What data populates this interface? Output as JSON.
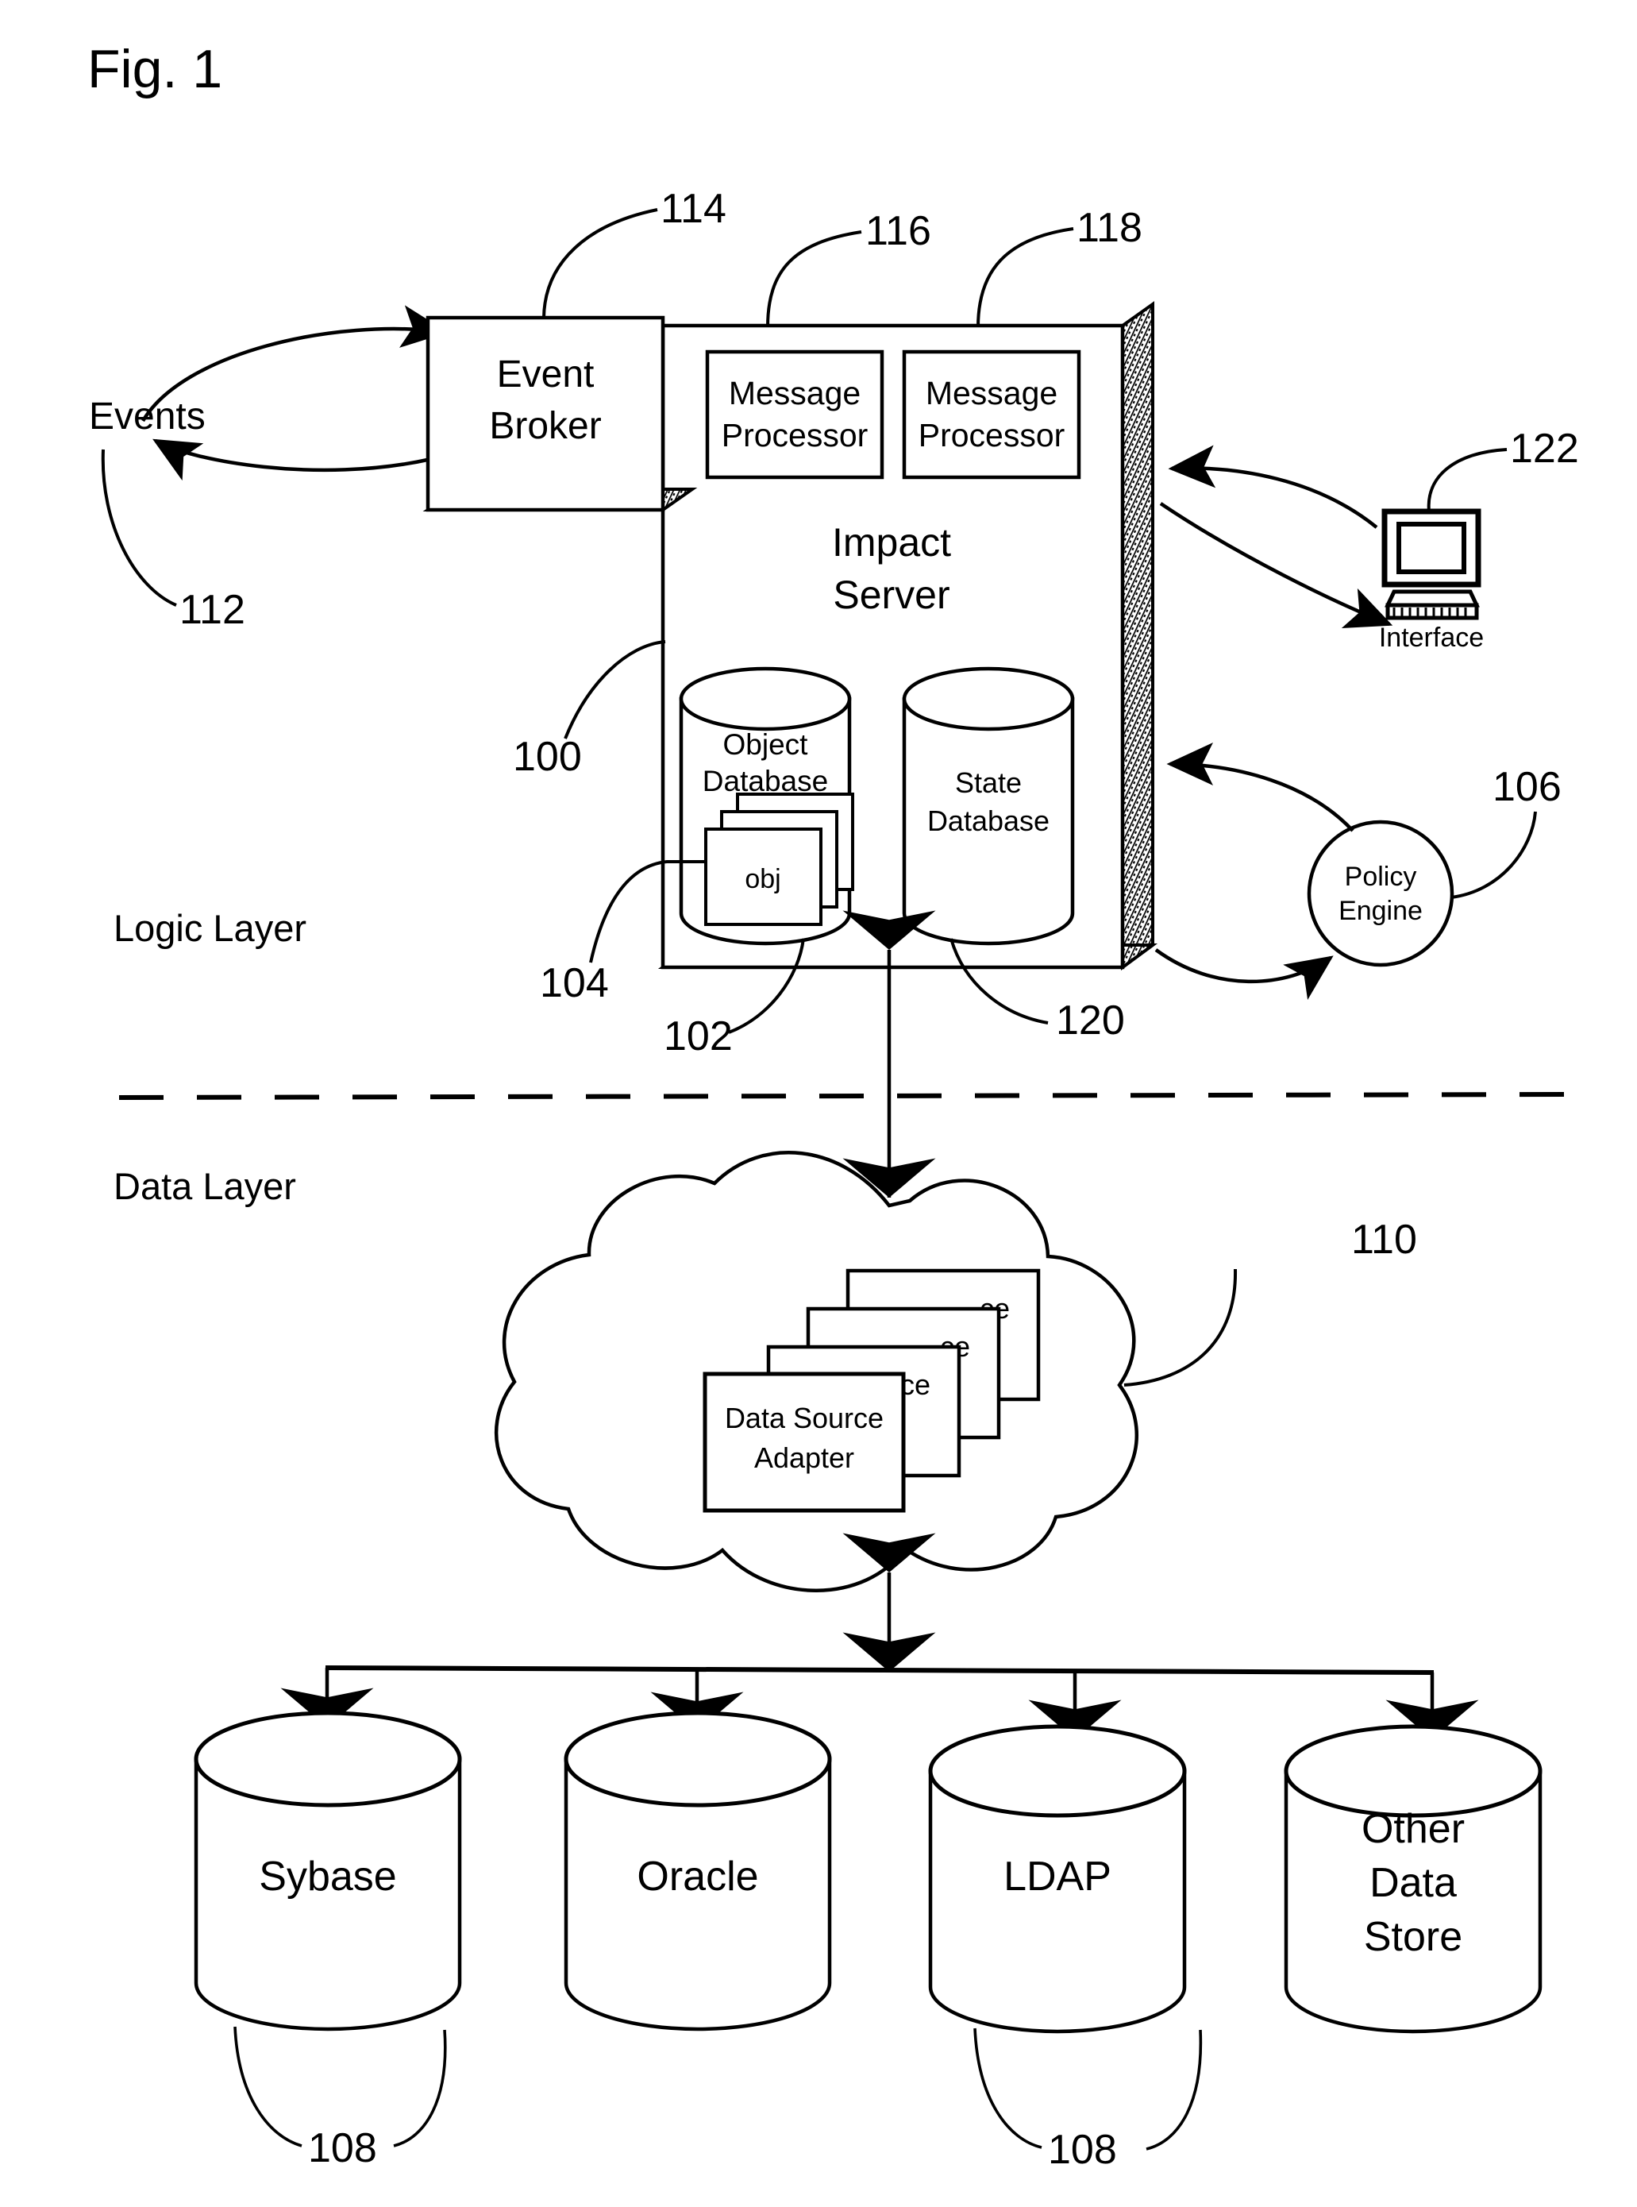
{
  "figure": {
    "title": "Fig. 1",
    "background_color": "#ffffff",
    "line_color": "#000000"
  },
  "layers": {
    "logic_label": "Logic Layer",
    "data_label": "Data Layer"
  },
  "events": {
    "label": "Events",
    "ref": "112"
  },
  "logic_layer": {
    "event_broker": {
      "line1": "Event",
      "line2": "Broker",
      "ref": "114"
    },
    "message_processor_1": {
      "line1": "Message",
      "line2": "Processor",
      "ref": "116"
    },
    "message_processor_2": {
      "line1": "Message",
      "line2": "Processor",
      "ref": "118"
    },
    "impact_server": {
      "line1": "Impact",
      "line2": "Server",
      "ref": "100"
    },
    "object_database": {
      "line1": "Object",
      "line2": "Database",
      "ref": "102"
    },
    "object_item": {
      "label": "obj",
      "ref": "104"
    },
    "state_database": {
      "line1": "State",
      "line2": "Database",
      "ref": "120"
    },
    "interface": {
      "label": "Interface",
      "ref": "122"
    },
    "policy_engine": {
      "line1": "Policy",
      "line2": "Engine",
      "ref": "106"
    }
  },
  "data_layer": {
    "cloud": {
      "ref": "110"
    },
    "adapters": {
      "front_line1": "Data Source",
      "front_line2": "Adapter",
      "back_fragment": "ce",
      "count": 4
    },
    "stores": [
      {
        "lines": [
          "Sybase"
        ],
        "ref": "108"
      },
      {
        "lines": [
          "Oracle"
        ],
        "ref": "108"
      },
      {
        "lines": [
          "LDAP"
        ],
        "ref": "108"
      },
      {
        "lines": [
          "Other",
          "Data",
          "Store"
        ],
        "ref": "108"
      }
    ],
    "store_refs": [
      "108",
      "108"
    ]
  }
}
